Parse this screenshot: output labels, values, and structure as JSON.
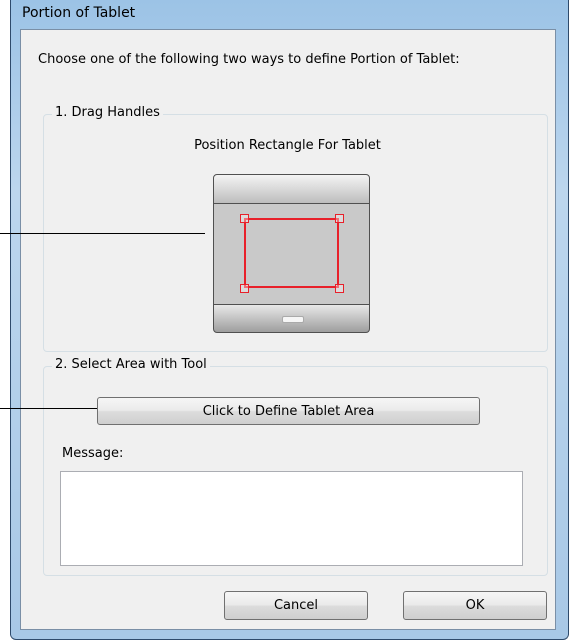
{
  "window": {
    "title": "Portion of Tablet"
  },
  "instruction": "Choose one of the following two ways to define Portion of Tablet:",
  "drag_handles": {
    "title": "1. Drag Handles",
    "caption": "Position Rectangle For Tablet"
  },
  "select_area": {
    "title": "2. Select Area with Tool",
    "define_button": "Click to Define Tablet Area",
    "message_label": "Message:",
    "message_value": ""
  },
  "footer": {
    "cancel": "Cancel",
    "ok": "OK"
  },
  "colors": {
    "selection_rectangle": "#e8202a"
  }
}
